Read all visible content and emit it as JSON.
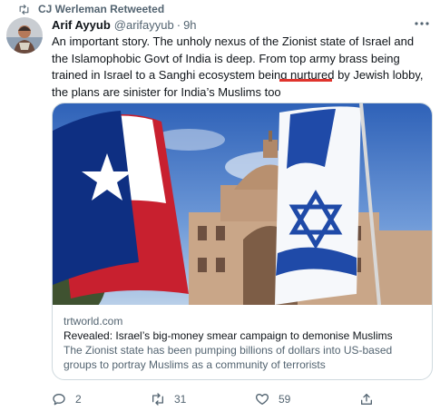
{
  "retweet": {
    "label": "CJ Werleman Retweeted",
    "icon": "retweet-icon"
  },
  "tweet": {
    "author_name": "Arif Ayyub",
    "author_handle": "@arifayyub",
    "separator": "·",
    "time": "9h",
    "text": "An important story. The unholy nexus of the Zionist state of Israel and the Islamophobic Govt of India is deep. From top army brass being trained in Israel to a Sanghi ecosystem being nurtured by Jewish lobby, the plans are sinister for India’s Muslims too"
  },
  "card": {
    "domain": "trtworld.com",
    "title": "Revealed: Israel’s big-money smear campaign to demonise Muslims",
    "description": "The Zionist state has been pumping billions of dollars into US-based groups to portray Muslims as a community of terrorists"
  },
  "actions": {
    "reply_count": "2",
    "retweet_count": "31",
    "like_count": "59"
  },
  "colors": {
    "text_primary": "#0f1419",
    "text_secondary": "#536471",
    "border": "#cfd9de",
    "highlight_underline": "#e0342d"
  }
}
